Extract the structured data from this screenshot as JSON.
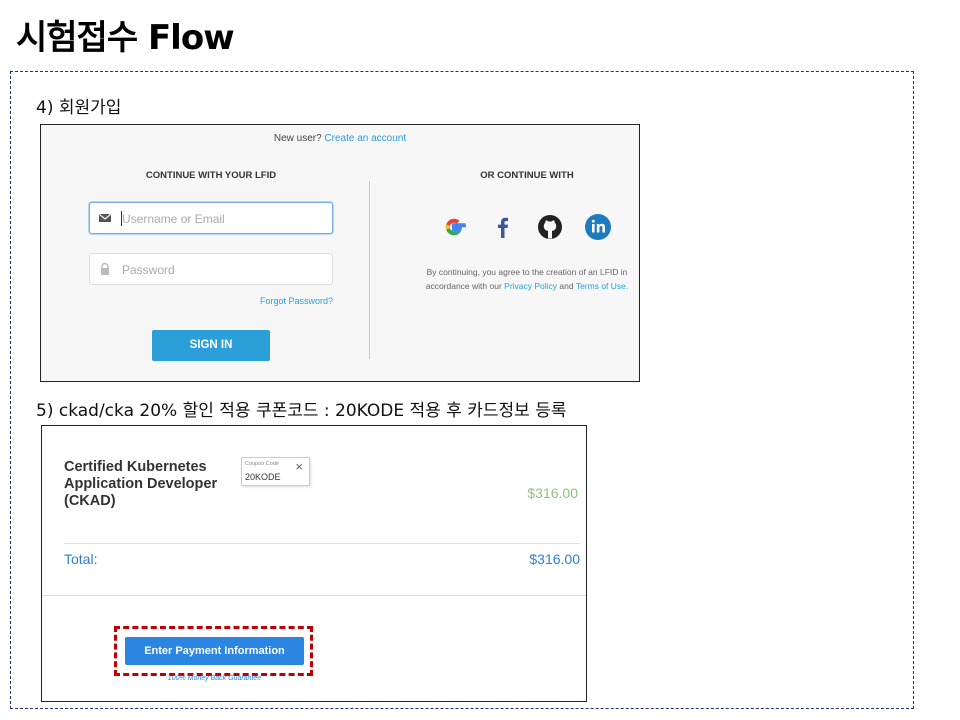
{
  "slide": {
    "title": "시험접수 Flow",
    "step4_label": "4) 회원가입",
    "step5_label": "5) ckad/cka 20% 할인 적용 쿠폰코드 : 20KODE 적용 후 카드정보 등록"
  },
  "login": {
    "new_user_prefix": "New user? ",
    "create_account_link": "Create an account",
    "lfid_title": "CONTINUE WITH YOUR LFID",
    "username_placeholder": "Username or Email",
    "password_placeholder": "Password",
    "forgot_password": "Forgot Password?",
    "sign_in": "SIGN IN",
    "or_title": "OR CONTINUE WITH",
    "social": [
      "google-icon",
      "facebook-icon",
      "github-icon",
      "linkedin-icon"
    ],
    "terms_prefix": "By continuing, you agree to the creation of an LFID in accordance with our ",
    "privacy_link": "Privacy Policy",
    "terms_and": " and ",
    "terms_link": "Terms of Use",
    "terms_suffix": ".",
    "accent_color": "#2a9fd8"
  },
  "checkout": {
    "product_name": "Certified Kubernetes Application Developer (CKAD)",
    "coupon_label": "Coupon Code",
    "coupon_value": "20KODE",
    "coupon_clear": "×",
    "price": "$316.00",
    "total_label": "Total:",
    "total_value": "$316.00",
    "pay_button": "Enter Payment Information",
    "money_back": "100% Money Back Guarantee",
    "price_color": "#8dc67b",
    "highlight_color": "#c00000"
  }
}
